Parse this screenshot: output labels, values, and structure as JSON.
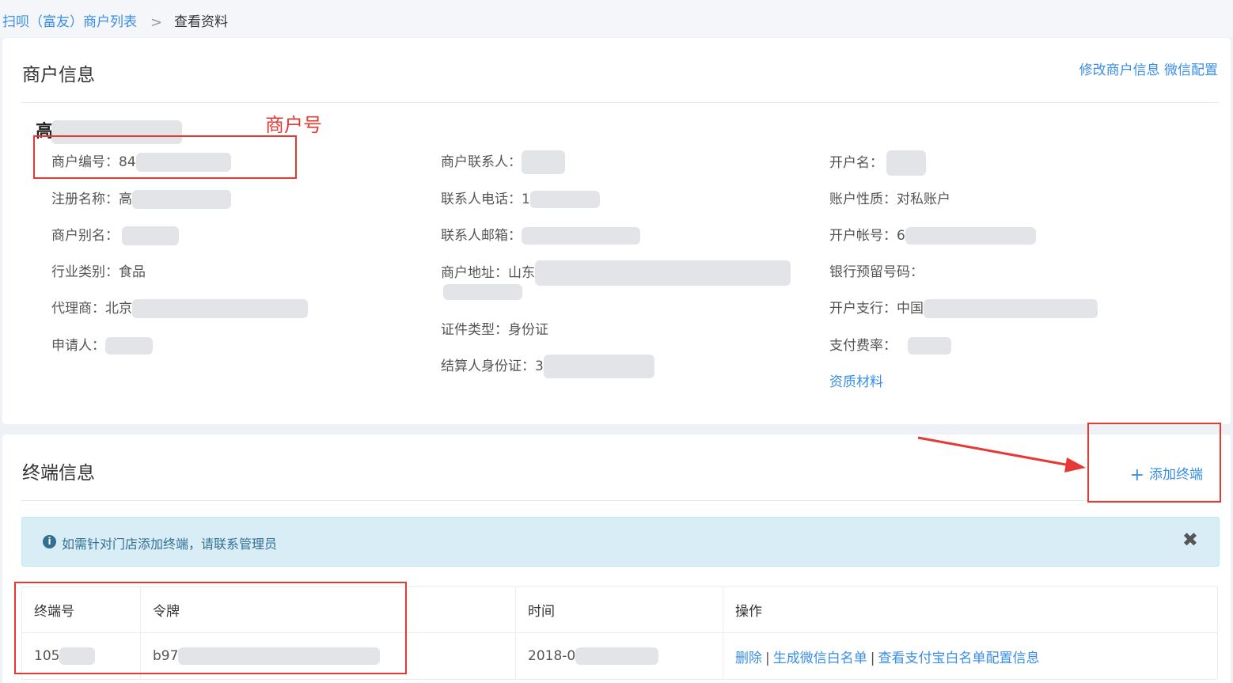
{
  "breadcrumb": {
    "parent": "扫呗（富友）商户列表",
    "separator": ">",
    "current": "查看资料"
  },
  "merchant_card": {
    "title": "商户信息",
    "edit_link": "修改商户信息",
    "wechat_link": "微信配置",
    "name_prefix": "高",
    "col1": [
      {
        "label": "商户编号：",
        "value": "84"
      },
      {
        "label": "注册名称：",
        "value": "高"
      },
      {
        "label": "商户别名：",
        "value": ""
      },
      {
        "label": "行业类别：",
        "value": "食品"
      },
      {
        "label": "代理商：",
        "value": "北京"
      },
      {
        "label": "申请人：",
        "value": ""
      }
    ],
    "col2": [
      {
        "label": "商户联系人：",
        "value": ""
      },
      {
        "label": "联系人电话：",
        "value": "1"
      },
      {
        "label": "联系人邮箱：",
        "value": ""
      },
      {
        "label": "商户地址：",
        "value": "山东"
      },
      {
        "label": "证件类型：",
        "value": "身份证"
      },
      {
        "label": "结算人身份证：",
        "value": "3"
      }
    ],
    "col3": [
      {
        "label": "开户名：",
        "value": ""
      },
      {
        "label": "账户性质：",
        "value": "对私账户"
      },
      {
        "label": "开户帐号：",
        "value": "6"
      },
      {
        "label": "银行预留号码：",
        "value": ""
      },
      {
        "label": "开户支行：",
        "value": "中国"
      },
      {
        "label": "支付费率：",
        "value": ""
      }
    ],
    "qualification_link": "资质材料"
  },
  "annotations": {
    "merchant_no": "商户号"
  },
  "terminal_card": {
    "title": "终端信息",
    "add_button": "添加终端",
    "alert_text": "如需针对门店添加终端，请联系管理员",
    "table": {
      "headers": [
        "终端号",
        "令牌",
        "时间",
        "操作"
      ],
      "rows": [
        {
          "terminal": "105",
          "token": "b97",
          "time": "2018-0"
        }
      ],
      "actions": [
        "删除",
        "生成微信白名单",
        "查看支付宝白名单配置信息"
      ]
    }
  },
  "icons": {
    "info": "info-circle-icon",
    "close": "close-icon",
    "plus": "plus-icon",
    "chevron": "chevron-right-icon"
  },
  "colors": {
    "link": "#3a8ee6",
    "annotation": "#e53935",
    "alert_bg": "#d9edf7"
  }
}
